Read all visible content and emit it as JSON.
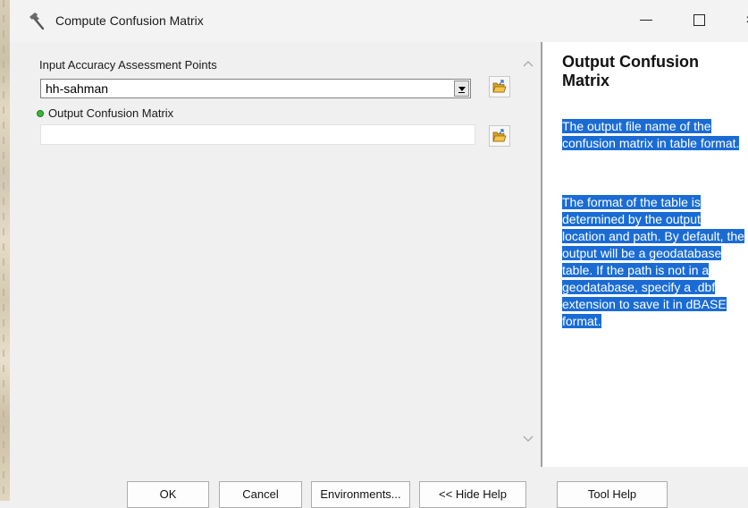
{
  "window": {
    "title": "Compute Confusion Matrix",
    "controls": {
      "minimize": "—",
      "maximize": "☐",
      "close": "×"
    }
  },
  "params": {
    "input_points": {
      "label": "Input Accuracy Assessment Points",
      "value": "hh-sahman",
      "browse_icon": "open-folder-icon"
    },
    "output_matrix": {
      "label": "Output Confusion Matrix",
      "value": "",
      "required": true,
      "required_color": "#3cb53c",
      "browse_icon": "open-folder-icon"
    }
  },
  "help": {
    "title": "Output Confusion Matrix",
    "paragraph1": "The output file name of the confusion matrix in table format.",
    "paragraph2": "The format of the table is determined by the output location and path. By default, the output will be a geodatabase table. If the path is not in a geodatabase, specify a .dbf extension to save it in dBASE format.",
    "highlight_color": "#1a6cd4"
  },
  "buttons": {
    "ok": "OK",
    "cancel": "Cancel",
    "environments": "Environments...",
    "hide_help": "<< Hide Help",
    "tool_help": "Tool Help"
  }
}
